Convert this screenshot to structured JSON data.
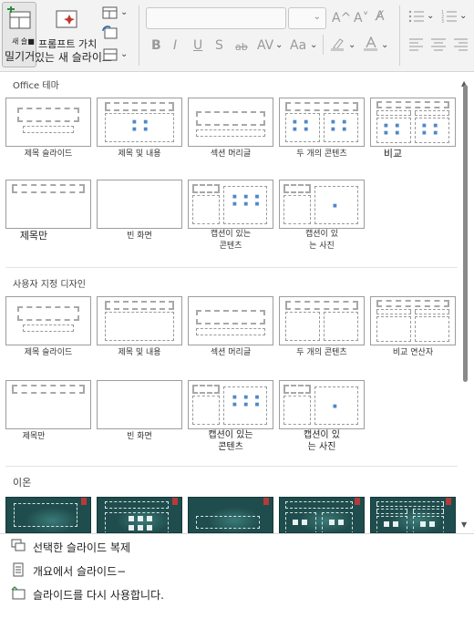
{
  "ribbon": {
    "new_slide_small": "새 슬■",
    "new_slide_label": "밀기거",
    "designer_label_line1": "프롬프트 가치",
    "designer_label_line2": "있는 새 슬라이드",
    "font_size_up": "A^",
    "font_size_down": "A˅",
    "bold": "B",
    "italic": "I",
    "underline": "U",
    "shadow": "S",
    "strike": "ab",
    "spacing": "AV",
    "case": "Aa"
  },
  "gallery": {
    "office_theme_title": "Office 테마",
    "office_layouts": [
      "제목 슬라이드",
      "제목 및 내용",
      "섹션 머리글",
      "두 개의 콘텐츠",
      "비교",
      "제목만",
      "빈 화면",
      "캡션이 있는\n콘텐츠",
      "캡션이 있\n는 사진"
    ],
    "custom_title": "사용자 지정 디자인",
    "custom_layouts": [
      "제목 슬라이드",
      "제목 및 내용",
      "섹션 머리글",
      "두 개의 콘텐츠",
      "비교 연산자",
      "제목만",
      "빈 화면",
      "캡션이 있는\n콘텐츠",
      "캡션이 있\n는 사진"
    ],
    "ion_title": "이온"
  },
  "menu": {
    "duplicate": "선택한 슬라이드 복제",
    "from_outline": "개요에서 슬라이드−",
    "reuse": "슬라이드를 다시 사용합니다."
  },
  "colors": {
    "theme_dark": "#1f4c4c",
    "theme_accent": "#b43b3b",
    "thumb_dots": "#4f88c6"
  }
}
